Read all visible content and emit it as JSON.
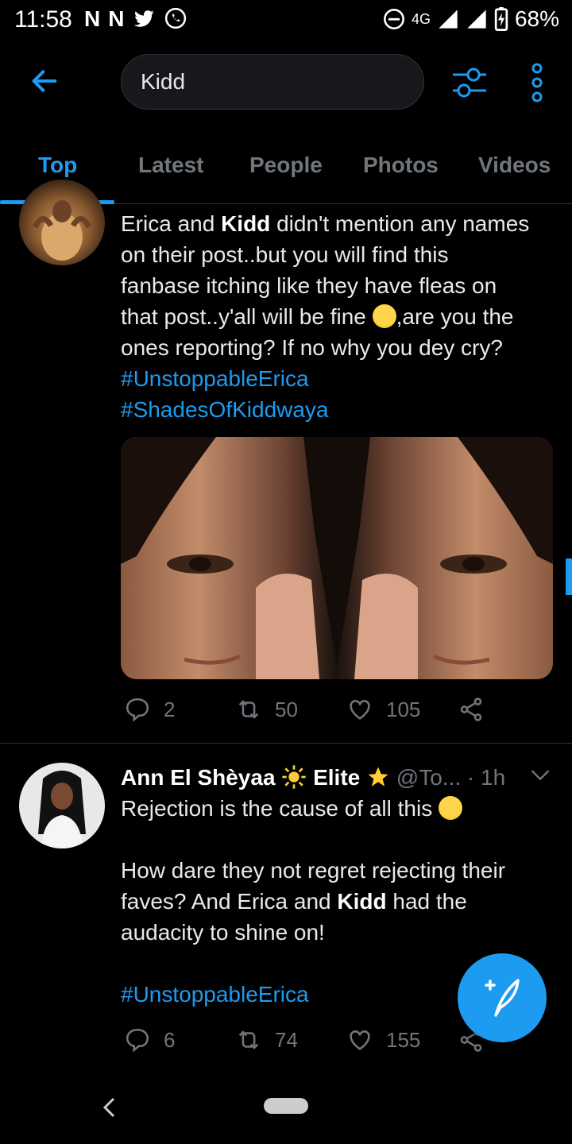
{
  "status_bar": {
    "time": "11:58",
    "left_icons": [
      "N",
      "N"
    ],
    "network": "4G",
    "battery": "68%"
  },
  "search": {
    "query": "Kidd"
  },
  "tabs": [
    {
      "label": "Top",
      "active": true
    },
    {
      "label": "Latest",
      "active": false
    },
    {
      "label": "People",
      "active": false
    },
    {
      "label": "Photos",
      "active": false
    },
    {
      "label": "Videos",
      "active": false
    }
  ],
  "tweets": [
    {
      "text_lines": [
        [
          "Erica and ",
          "Kidd",
          " didn't mention any names"
        ],
        "on their post..but you will find this",
        "fanbase itching like they have fleas on",
        "that post..y'all will be fine",
        ",are you the",
        "ones reporting? If no why you dey cry?"
      ],
      "hashtags": [
        "#UnstoppableErica",
        "#ShadesOfKiddwaya"
      ],
      "replies": "2",
      "retweets": "50",
      "likes": "105"
    },
    {
      "name": "Ann El Shèyaa",
      "badge": "Elite",
      "handle": "@To...",
      "time": "· 1h",
      "line1": "Rejection is the cause of all this",
      "body_a": "How dare they not regret rejecting their",
      "body_b": "faves? And Erica and ",
      "body_bold": "Kidd",
      "body_c": " had the",
      "body_d": "audacity to shine on!",
      "hashtags": [
        "#UnstoppableErica"
      ],
      "replies": "6",
      "retweets": "74",
      "likes": "155"
    }
  ],
  "colors": {
    "accent": "#1d9bf0",
    "background": "#000000",
    "muted": "#71767b"
  }
}
